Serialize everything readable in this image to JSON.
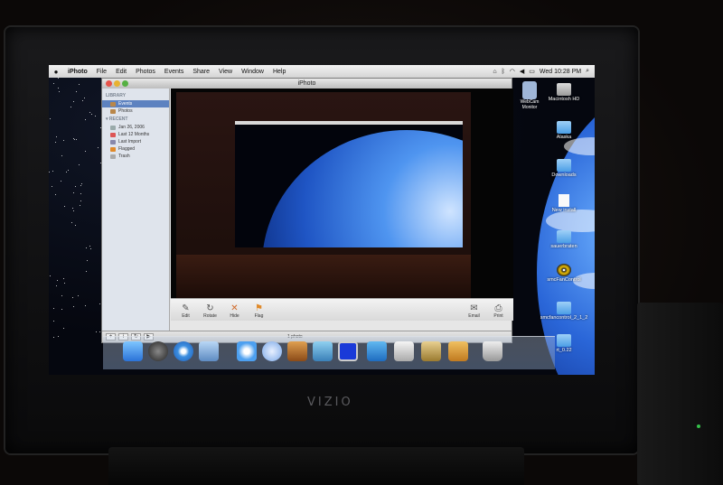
{
  "tv": {
    "brand": "VIZIO"
  },
  "menubar": {
    "apple_icon": "apple-icon",
    "app_name": "iPhoto",
    "menus": [
      "File",
      "Edit",
      "Photos",
      "Events",
      "Share",
      "View",
      "Window",
      "Help"
    ],
    "clock": "Wed 10:28 PM",
    "status_icons": [
      "home-icon",
      "bluetooth-icon",
      "wifi-icon",
      "volume-icon",
      "battery-icon"
    ]
  },
  "iphoto": {
    "title": "iPhoto",
    "source": {
      "library_header": "LIBRARY",
      "library_items": [
        {
          "label": "Events",
          "selected": true
        },
        {
          "label": "Photos",
          "selected": false
        }
      ],
      "recent_header": "RECENT",
      "recent_items": [
        "Jan 26, 2006",
        "Last 12 Months",
        "Last Import",
        "Flagged",
        "Trash"
      ]
    },
    "toolbar": {
      "left": [
        {
          "label": "Edit",
          "icon": "pencil-icon",
          "dim": false
        },
        {
          "label": "Rotate",
          "icon": "rotate-icon",
          "dim": false
        },
        {
          "label": "Hide",
          "icon": "hide-x-icon",
          "dim": false
        },
        {
          "label": "Flag",
          "icon": "flag-icon",
          "dim": false
        }
      ],
      "right": [
        {
          "label": "Email",
          "icon": "email-icon",
          "dim": false
        },
        {
          "label": "Print",
          "icon": "print-icon",
          "dim": false
        }
      ]
    },
    "status": {
      "count": "1 photo"
    },
    "bottom_buttons": [
      "+",
      "i",
      "↻",
      "▶"
    ]
  },
  "desktop_icons": [
    {
      "label": "Macintosh HD",
      "kind": "drive"
    },
    {
      "label": "Alaska",
      "kind": "folder"
    },
    {
      "label": "Downloads",
      "kind": "folder"
    },
    {
      "label": "New install",
      "kind": "doc"
    },
    {
      "label": "sauerbraten",
      "kind": "folder"
    },
    {
      "label": "smcFanControl",
      "kind": "disk"
    },
    {
      "label": "smcfancontrol_2_1_2",
      "kind": "folder"
    },
    {
      "label": "rt_0.22",
      "kind": "folder"
    }
  ],
  "webcam": {
    "label": "WebCam Monitor"
  },
  "dock": {
    "apps": [
      "finder-icon",
      "dashboard-icon",
      "safari-icon",
      "preview-icon",
      "adium-icon",
      "itunes-icon",
      "garageband-icon",
      "virtualbox-icon",
      "display-icon",
      "sketch-icon",
      "photo-icon",
      "iphoto-icon",
      "mail-stamp-icon",
      "trash-icon"
    ]
  },
  "colors": {
    "selection": "#5d82c0",
    "menubar": "#e4e4e4",
    "desktop_blue": "#2a66d8"
  }
}
